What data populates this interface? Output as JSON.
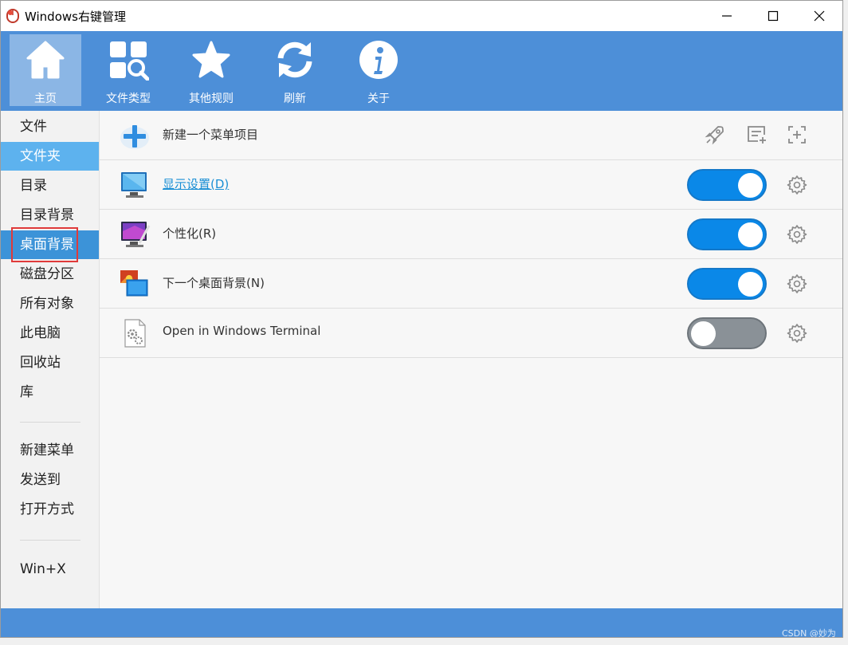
{
  "window": {
    "title": "Windows右键管理"
  },
  "toolbar": {
    "items": [
      {
        "label": "主页",
        "icon": "home-icon"
      },
      {
        "label": "文件类型",
        "icon": "file-type-search-icon"
      },
      {
        "label": "其他规则",
        "icon": "star-icon"
      },
      {
        "label": "刷新",
        "icon": "refresh-icon"
      },
      {
        "label": "关于",
        "icon": "info-icon"
      }
    ]
  },
  "sidebar": {
    "items": [
      {
        "label": "文件"
      },
      {
        "label": "文件夹"
      },
      {
        "label": "目录"
      },
      {
        "label": "目录背景"
      },
      {
        "label": "桌面背景"
      },
      {
        "label": "磁盘分区"
      },
      {
        "label": "所有对象"
      },
      {
        "label": "此电脑"
      },
      {
        "label": "回收站"
      },
      {
        "label": "库"
      },
      {
        "label": "新建菜单"
      },
      {
        "label": "发送到"
      },
      {
        "label": "打开方式"
      },
      {
        "label": "Win+X"
      }
    ]
  },
  "main": {
    "new_item_label": "新建一个菜单项目",
    "rows": [
      {
        "label": "显示设置(D)",
        "enabled": true,
        "icon": "monitor-icon"
      },
      {
        "label": "个性化(R)",
        "enabled": true,
        "icon": "personalize-icon"
      },
      {
        "label": "下一个桌面背景(N)",
        "enabled": true,
        "icon": "next-wallpaper-icon"
      },
      {
        "label": "Open in Windows Terminal",
        "enabled": false,
        "icon": "settings-file-icon"
      }
    ]
  },
  "footer": {
    "credit": "CSDN @妙为"
  },
  "colors": {
    "toolbar": "#4d8fd8",
    "toggle_on": "#0a88e8",
    "toggle_off": "#8a9197",
    "sidebar_selected": "#3c93d8",
    "highlight_box": "#e03a3a"
  }
}
